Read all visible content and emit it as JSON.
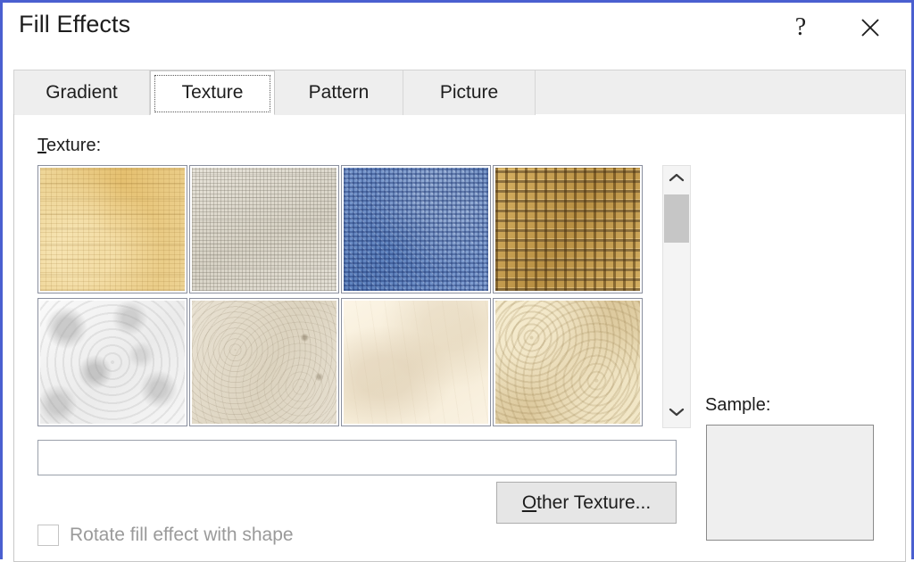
{
  "window": {
    "title": "Fill Effects",
    "frame_color": "#4a5fd0",
    "help_icon": "question-mark-icon",
    "close_icon": "close-icon",
    "help_glyph": "?"
  },
  "tabs": [
    {
      "label": "Gradient",
      "active": false
    },
    {
      "label": "Texture",
      "active": true
    },
    {
      "label": "Pattern",
      "active": false
    },
    {
      "label": "Picture",
      "active": false
    }
  ],
  "texture_panel": {
    "label_prefix": "T",
    "label_rest": "exture:",
    "label_full": "Texture:",
    "selected_index": -1,
    "name_field_value": "",
    "name_field_placeholder": "",
    "swatches": [
      {
        "name": "Papyrus",
        "color": "#e5c070",
        "row": 0,
        "col": 0
      },
      {
        "name": "Canvas",
        "color": "#d7d2c5",
        "row": 0,
        "col": 1
      },
      {
        "name": "Denim",
        "color": "#5d81bd",
        "row": 0,
        "col": 2
      },
      {
        "name": "Woven mat",
        "color": "#b88f42",
        "row": 0,
        "col": 3
      },
      {
        "name": "Water droplets",
        "color": "#ebebeb",
        "row": 1,
        "col": 0
      },
      {
        "name": "Paper bag",
        "color": "#dcd3bf",
        "row": 1,
        "col": 1
      },
      {
        "name": "Fish fossil",
        "color": "#f4ead4",
        "row": 1,
        "col": 2
      },
      {
        "name": "Sand",
        "color": "#dcc89c",
        "row": 1,
        "col": 3
      }
    ],
    "scrollbar": {
      "up_icon": "chevron-up-icon",
      "down_icon": "chevron-down-icon",
      "thumb_position": "near-top"
    }
  },
  "buttons": {
    "other_texture_prefix": "O",
    "other_texture_rest": "ther Texture...",
    "other_texture_full": "Other Texture..."
  },
  "sample": {
    "label": "Sample:",
    "value": ""
  },
  "checkbox": {
    "label": "Rotate fill effect with shape",
    "checked": false,
    "disabled": true
  }
}
